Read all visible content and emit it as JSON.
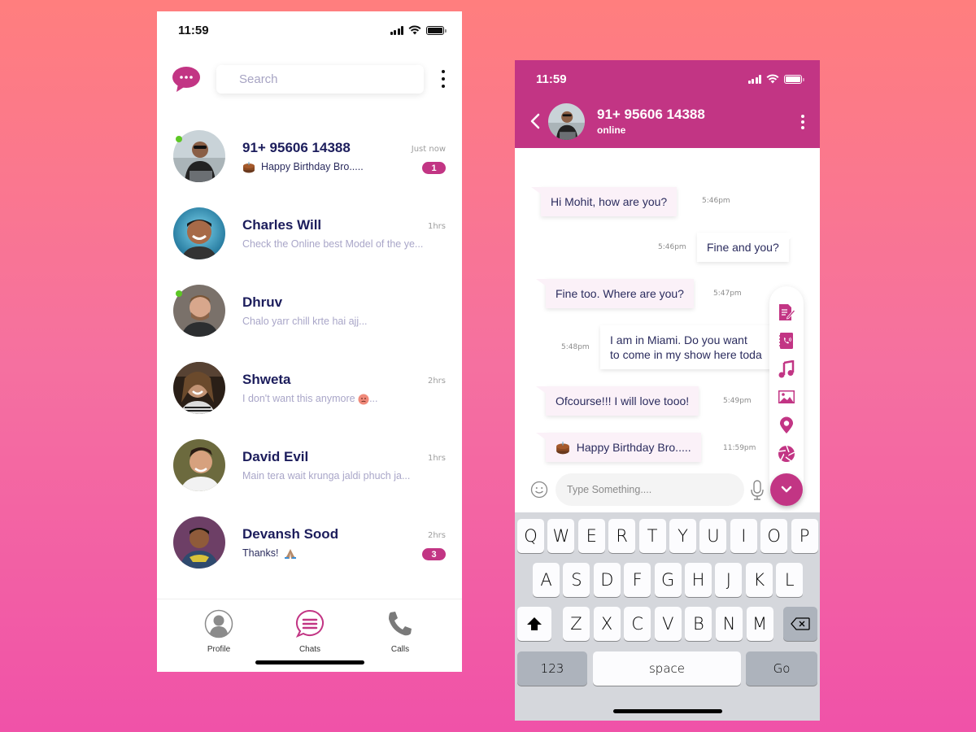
{
  "theme": {
    "accent": "#c23584",
    "name_color": "#1c1d5c",
    "online_color": "#5dc725",
    "bg_top": "#ff7e7e",
    "bg_bottom": "#f052a8"
  },
  "left_screen": {
    "status_bar": {
      "time": "11:59"
    },
    "search": {
      "placeholder": "Search"
    },
    "chats": [
      {
        "name": "91+ 95606 14388",
        "time": "Just now",
        "preview": "Happy Birthday Bro.....",
        "preview_emoji": "cake",
        "unread": "1",
        "online": true
      },
      {
        "name": "Charles Will",
        "time": "1hrs",
        "preview": "Check the Online best Model of the ye...",
        "unread": null,
        "online": false
      },
      {
        "name": "Dhruv",
        "time": "",
        "preview": "Chalo yarr chill krte hai ajj...",
        "unread": null,
        "online": true
      },
      {
        "name": "Shweta",
        "time": "2hrs",
        "preview": "I don't want this anymore",
        "preview_suffix": "...",
        "preview_emoji": "angry-face",
        "unread": null,
        "online": false
      },
      {
        "name": "David Evil",
        "time": "1hrs",
        "preview": "Main tera wait krunga jaldi phuch ja...",
        "unread": null,
        "online": false
      },
      {
        "name": "Devansh Sood",
        "time": "2hrs",
        "preview": "Thanks!",
        "preview_emoji": "folded-hands",
        "unread": "3",
        "online": false
      }
    ],
    "bottom_nav": [
      {
        "label": "Profile",
        "icon": "profile-icon",
        "active": false
      },
      {
        "label": "Chats",
        "icon": "chats-icon",
        "active": true
      },
      {
        "label": "Calls",
        "icon": "phone-icon",
        "active": false
      }
    ]
  },
  "right_screen": {
    "status_bar": {
      "time": "11:59"
    },
    "header": {
      "contact": "91+ 95606 14388",
      "status": "online"
    },
    "messages": [
      {
        "direction": "in",
        "text": "Hi Mohit, how are you?",
        "time": "5:46pm"
      },
      {
        "direction": "out",
        "text": "Fine and you?",
        "time": "5:46pm"
      },
      {
        "direction": "in",
        "text": "Fine too. Where are you?",
        "time": "5:47pm"
      },
      {
        "direction": "out",
        "text_line1": "I am in Miami. Do you want",
        "text_line2": "to come in my show here toda",
        "time": "5:48pm"
      },
      {
        "direction": "in",
        "text": "Ofcourse!!! I will love tooo!",
        "time": "5:49pm"
      },
      {
        "direction": "in",
        "text": "Happy Birthday Bro.....",
        "emoji": "cake",
        "time": "11:59pm"
      }
    ],
    "attach_menu": [
      "document-icon",
      "contact-icon",
      "music-icon",
      "image-icon",
      "location-icon",
      "camera-icon"
    ],
    "input": {
      "placeholder": "Type Something....",
      "value": ""
    },
    "keyboard": {
      "row1": [
        "Q",
        "W",
        "E",
        "R",
        "T",
        "Y",
        "U",
        "I",
        "O",
        "P"
      ],
      "row2": [
        "A",
        "S",
        "D",
        "F",
        "G",
        "H",
        "J",
        "K",
        "L"
      ],
      "row3": [
        "Z",
        "X",
        "C",
        "V",
        "B",
        "N",
        "M"
      ],
      "numbers_label": "123",
      "space_label": "space",
      "go_label": "Go"
    }
  }
}
